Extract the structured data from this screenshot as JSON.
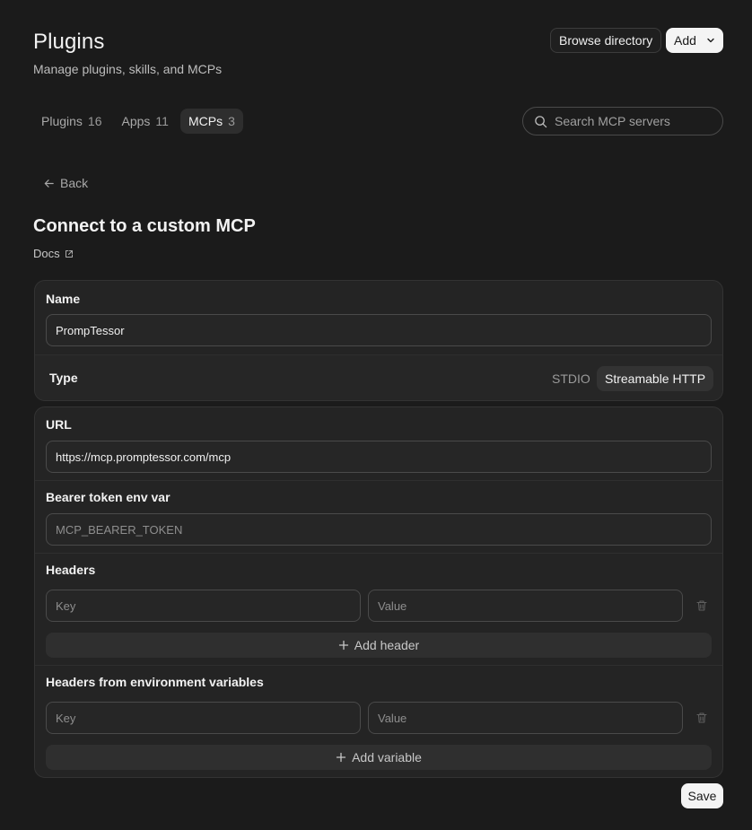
{
  "header": {
    "title": "Plugins",
    "subtitle": "Manage plugins, skills, and MCPs",
    "browse_label": "Browse directory",
    "add_label": "Add"
  },
  "tabs": [
    {
      "label": "Plugins",
      "count": "16"
    },
    {
      "label": "Apps",
      "count": "11"
    },
    {
      "label": "MCPs",
      "count": "3"
    }
  ],
  "search": {
    "placeholder": "Search MCP servers"
  },
  "back_label": "Back",
  "form": {
    "heading": "Connect to a custom MCP",
    "docs_label": "Docs",
    "name_label": "Name",
    "name_value": "PrompTessor",
    "type_label": "Type",
    "type_options": [
      "STDIO",
      "Streamable HTTP"
    ],
    "type_selected": "Streamable HTTP",
    "url_label": "URL",
    "url_value": "https://mcp.promptessor.com/mcp",
    "bearer_label": "Bearer token env var",
    "bearer_placeholder": "MCP_BEARER_TOKEN",
    "headers_label": "Headers",
    "key_placeholder": "Key",
    "value_placeholder": "Value",
    "add_header_label": "Add header",
    "env_headers_label": "Headers from environment variables",
    "add_variable_label": "Add variable",
    "save_label": "Save"
  },
  "colors": {
    "background": "#1b1b1b",
    "card": "#242424",
    "primary_button": "#f4f4f4"
  }
}
